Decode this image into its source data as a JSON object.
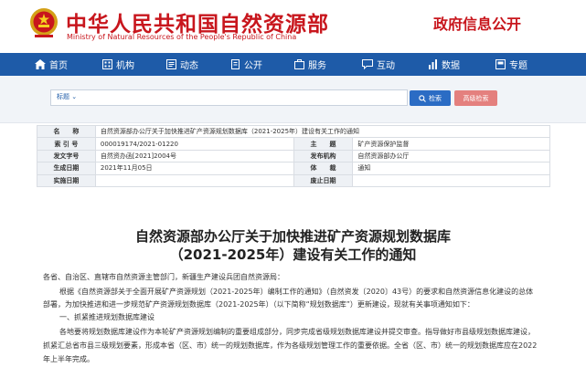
{
  "header": {
    "emblem_icon": "national-emblem-icon",
    "title_cn": "中华人民共和国自然资源部",
    "title_en": "Ministry of Natural Resources of the People's Republic of China",
    "right_label": "政府信息公开",
    "brand_color": "#c8161d"
  },
  "nav": {
    "bg_color": "#1e5ba8",
    "items": [
      {
        "label": "首页",
        "icon": "home-icon"
      },
      {
        "label": "机构",
        "icon": "organization-icon"
      },
      {
        "label": "动态",
        "icon": "news-icon"
      },
      {
        "label": "公开",
        "icon": "open-info-icon"
      },
      {
        "label": "服务",
        "icon": "service-icon"
      },
      {
        "label": "互动",
        "icon": "chat-icon"
      },
      {
        "label": "数据",
        "icon": "data-icon"
      },
      {
        "label": "专题",
        "icon": "topic-icon"
      }
    ]
  },
  "search": {
    "scope_label": "标题",
    "search_button": "检索",
    "advanced_button": "高级检索"
  },
  "info": {
    "name_label": "名　　称",
    "name_value": "自然资源部办公厅关于加快推进矿产资源规划数据库（2021-2025年）建设有关工作的通知",
    "index_label": "索 引 号",
    "index_value": "000019174/2021-01220",
    "topic_label": "主　　题",
    "topic_value": "矿产资源保护监督",
    "doc_no_label": "发文字号",
    "doc_no_value": "自然资办函[2021]2004号",
    "issuer_label": "发布机构",
    "issuer_value": "自然资源部办公厅",
    "date_label": "生成日期",
    "date_value": "2021年11月05日",
    "genre_label": "体　　裁",
    "genre_value": "通知",
    "effective_label": "实施日期",
    "effective_value": "",
    "expiry_label": "废止日期",
    "expiry_value": ""
  },
  "article": {
    "title_line1": "自然资源部办公厅关于加快推进矿产资源规划数据库",
    "title_line2": "（2021-2025年）建设有关工作的通知",
    "salutation": "各省、自治区、直辖市自然资源主管部门，新疆生产建设兵团自然资源局：",
    "p1_line1": "根据《自然资源部关于全面开展矿产资源规划（2021-2025年）编制工作的通知》（自然资发〔2020〕43号）的要求和自然资源信息化建设的总体",
    "p1_line2": "部署，为加快推进和进一步规范矿产资源规划数据库（2021-2025年）（以下简称“规划数据库”）更新建设，现就有关事项通知如下：",
    "section1": "一、抓紧推进规划数据库建设",
    "p2_line1": "各地要将规划数据库建设作为本轮矿产资源规划编制的重要组成部分，同步完成省级规划数据库建设并提交审查。指导做好市县级规划数据库建设，",
    "p2_line2": "抓紧汇总省市县三级规划要素，形成本省（区、市）统一的规划数据库，作为各级规划管理工作的重要依据。全省（区、市）统一的规划数据库应在2022",
    "p2_line3": "年上半年完成。"
  }
}
